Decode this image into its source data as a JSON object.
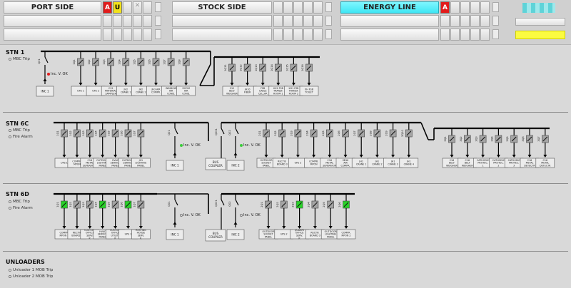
{
  "header": {
    "port_side": {
      "title": "PORT SIDE",
      "badge_a": "A",
      "badge_u": "U"
    },
    "stock_side": {
      "title": "STOCK SIDE"
    },
    "energy_line": {
      "title": "ENERGY LINE",
      "badge_a": "A"
    }
  },
  "colors": {
    "background": "#d9d9d9",
    "cyan": "#3fe6f4",
    "alarm_red": "#e21b1b",
    "warn_yellow": "#f2e21a",
    "breaker_green": "#28d228",
    "status_yellow": "#fbfb40"
  },
  "sections": {
    "stn1": {
      "title": "STN 1",
      "alarms": [
        "MBC Trip"
      ]
    },
    "stn6c": {
      "title": "STN 6C",
      "alarms": [
        "MBC Trip",
        "Fire Alarm"
      ]
    },
    "stn6d": {
      "title": "STN 6D",
      "alarms": [
        "MBC Trip",
        "Fire Alarm"
      ]
    },
    "unloaders": {
      "title": "UNLOADERS",
      "alarms": [
        "Unloader 1 MOB Trip",
        "Unloader 2 MOB Trip"
      ]
    }
  },
  "diagram": {
    "incv_label": "Inc. V. OK",
    "stn1": {
      "incomer": {
        "code": "Q01",
        "label": "INC 1"
      },
      "bus_a": [
        {
          "code": "1Q1",
          "label": "UPS 1"
        },
        {
          "code": "1Q2",
          "label": "UPS 2"
        },
        {
          "code": "1Q3",
          "label": "C12 MATERIAL SAMPLER"
        },
        {
          "code": "1Q4",
          "label": "JH2 CRANE 1"
        },
        {
          "code": "1Q5",
          "label": "JH2 CRANE 2"
        },
        {
          "code": "1Q6",
          "label": "JH3 AIR COMPR."
        },
        {
          "code": "1Q7",
          "label": "WINDOW AIR COND."
        },
        {
          "code": "1Q8",
          "label": "ROOM AIR COND."
        }
      ],
      "bus_b": [
        {
          "code": "1Q11",
          "label": "C12 BELT WEIGHER"
        },
        {
          "code": "1Q12",
          "label": "JH10 FIBER"
        },
        {
          "code": "1Q13",
          "label": "FSB CABLE CELLAR"
        },
        {
          "code": "1Q14",
          "label": "XH1 FSB TRANSF. ROOM 1"
        },
        {
          "code": "1Q15",
          "label": "XH1 FSB TRANSF. ROOM 2"
        },
        {
          "code": "1Q16",
          "label": "XH FSB TOILET"
        }
      ]
    },
    "stn6c": {
      "bus_a": [
        {
          "code": "1Q1",
          "label": "UPS 1"
        },
        {
          "code": "1Q2",
          "label": "COMPR. MPON"
        },
        {
          "code": "1Q3",
          "label": "C16 METAL SEPERATOR"
        },
        {
          "code": "1Q4",
          "label": "OUTDOOR LIGHTING PANEL"
        },
        {
          "code": "1Q5",
          "label": "HVAC SERVICE PANEL"
        },
        {
          "code": "1Q6",
          "label": "OUTDOOR SERVICE PANEL"
        },
        {
          "code": "1Q7",
          "label": "JH1 LIGHTING PANEL"
        }
      ],
      "incomer1": {
        "code": "Q01",
        "label": "INC 1"
      },
      "coupler": {
        "code": "Q001",
        "label": "BUS COUPLER"
      },
      "incomer2": {
        "code": "Q02",
        "label": "INC 2"
      },
      "bus_b": [
        {
          "code": "2Q1",
          "label": "OUTDOOR SOCKET PANEL"
        },
        {
          "code": "2Q2",
          "label": "RECTIF. BOARD 3"
        },
        {
          "code": "2Q3",
          "label": "UPS 2"
        },
        {
          "code": "2Q4",
          "label": "COMPR. MPON"
        },
        {
          "code": "2Q5",
          "label": "C16 METAL SEPERATOR"
        },
        {
          "code": "2Q6",
          "label": "SB10 AIR COMPR."
        },
        {
          "code": "2Q7",
          "label": "JH1 CRANE 1"
        },
        {
          "code": "2Q8",
          "label": "JH1 CRANE 2"
        },
        {
          "code": "2Q9",
          "label": "JH1 CRANE 3"
        },
        {
          "code": "2Q10",
          "label": "JH1 CRANE 4"
        }
      ],
      "bus_c": [
        {
          "code": "3Q1",
          "label": "C16 BELT WEIGHER"
        },
        {
          "code": "3Q2",
          "label": "C16 BELT WEIGHER"
        },
        {
          "code": "3Q3",
          "label": "CATHODIC PROTEC. 1"
        },
        {
          "code": "3Q4",
          "label": "CATHODIC PROTEC. 2"
        },
        {
          "code": "3Q5",
          "label": "CATHODIC PROTEC. 3"
        },
        {
          "code": "3Q6",
          "label": "C16 METAL DETECTR"
        },
        {
          "code": "3Q7",
          "label": "C16 METAL DETECTR"
        }
      ]
    },
    "stn6d": {
      "bus_a": [
        {
          "code": "1Q1",
          "label": "COMPR. MPON 1",
          "on": true
        },
        {
          "code": "1Q2",
          "label": "RECTIF. BOARD 1",
          "on": false
        },
        {
          "code": "1Q3",
          "label": "CUSTOM. OFFICE SERV. P.",
          "on": false
        },
        {
          "code": "1Q4",
          "label": "HVAC SERVICE PANEL",
          "on": true
        },
        {
          "code": "1Q5",
          "label": "CUSTOM. OFFICE UTILITY P.",
          "on": false
        },
        {
          "code": "1Q6",
          "label": "UPS 1",
          "on": true
        },
        {
          "code": "1Q7",
          "label": "RESTING HOUSE SERV. P.",
          "on": false
        }
      ],
      "incomer1": {
        "code": "Q01",
        "label": "INC 1"
      },
      "coupler": {
        "code": "Q001",
        "label": "BUS COUPLER"
      },
      "incomer2": {
        "code": "Q02",
        "label": "INC 2"
      },
      "bus_b": [
        {
          "code": "2Q1",
          "label": "OUTDOOR SOCKET PANEL",
          "on": false
        },
        {
          "code": "2Q2",
          "label": "UPS 2",
          "on": false
        },
        {
          "code": "2Q3",
          "label": "QUARRY OFFICE SERV. P.",
          "on": true
        },
        {
          "code": "2Q4",
          "label": "RECTIF. BOARD 3",
          "on": false
        },
        {
          "code": "2Q5",
          "label": "OUTDOOR LIGHTING PANEL",
          "on": false
        },
        {
          "code": "2Q6",
          "label": "COMPR. MPON 2",
          "on": true
        }
      ]
    }
  }
}
